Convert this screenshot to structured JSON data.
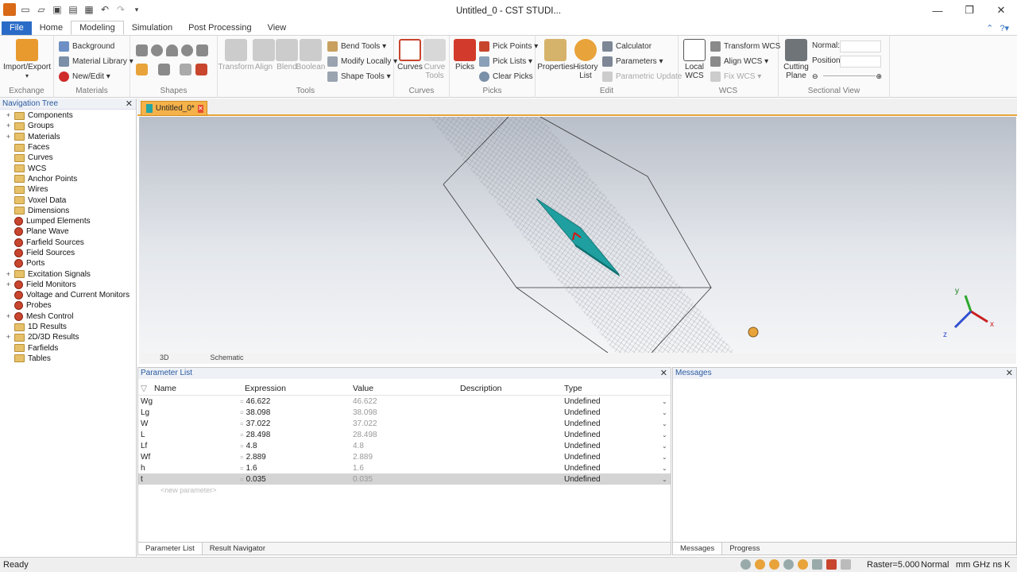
{
  "window": {
    "title": "Untitled_0 - CST STUDI..."
  },
  "ribbon_tabs": [
    {
      "label": "File"
    },
    {
      "label": "Home"
    },
    {
      "label": "Modeling"
    },
    {
      "label": "Simulation"
    },
    {
      "label": "Post Processing"
    },
    {
      "label": "View"
    }
  ],
  "ribbon": {
    "exchange": {
      "label": "Exchange",
      "import_export": "Import/Export"
    },
    "materials": {
      "label": "Materials",
      "background": "Background",
      "material_library": "Material Library ▾",
      "new_edit": "New/Edit ▾"
    },
    "shapes": {
      "label": "Shapes"
    },
    "tools": {
      "label": "Tools",
      "transform": "Transform",
      "align": "Align",
      "blend": "Blend",
      "boolean": "Boolean",
      "bend_tools": "Bend Tools ▾",
      "modify_locally": "Modify Locally ▾",
      "shape_tools": "Shape Tools ▾"
    },
    "curves": {
      "label": "Curves",
      "curves": "Curves",
      "curve_tools": "Curve Tools"
    },
    "picks": {
      "label": "Picks",
      "picks": "Picks",
      "pick_points": "Pick Points ▾",
      "pick_lists": "Pick Lists ▾",
      "clear_picks": "Clear Picks"
    },
    "edit": {
      "label": "Edit",
      "properties": "Properties",
      "history_list": "History List",
      "calculator": "Calculator",
      "parameters": "Parameters ▾",
      "parametric_update": "Parametric Update"
    },
    "wcs": {
      "label": "WCS",
      "local_wcs": "Local WCS",
      "transform_wcs": "Transform WCS",
      "align_wcs": "Align WCS ▾",
      "fix_wcs": "Fix WCS ▾"
    },
    "sectional": {
      "label": "Sectional View",
      "cutting_plane": "Cutting Plane",
      "normal_label": "Normal:",
      "position_label": "Position:"
    }
  },
  "nav_tree": {
    "title": "Navigation Tree",
    "items": [
      {
        "label": "Components",
        "expand": "+",
        "icon": "folder"
      },
      {
        "label": "Groups",
        "expand": "+",
        "icon": "folder"
      },
      {
        "label": "Materials",
        "expand": "+",
        "icon": "folder"
      },
      {
        "label": "Faces",
        "expand": "",
        "icon": "folder"
      },
      {
        "label": "Curves",
        "expand": "",
        "icon": "folder"
      },
      {
        "label": "WCS",
        "expand": "",
        "icon": "folder"
      },
      {
        "label": "Anchor Points",
        "expand": "",
        "icon": "folder"
      },
      {
        "label": "Wires",
        "expand": "",
        "icon": "folder"
      },
      {
        "label": "Voxel Data",
        "expand": "",
        "icon": "folder"
      },
      {
        "label": "Dimensions",
        "expand": "",
        "icon": "folder"
      },
      {
        "label": "Lumped Elements",
        "expand": "",
        "icon": "red-folder"
      },
      {
        "label": "Plane Wave",
        "expand": "",
        "icon": "red-folder"
      },
      {
        "label": "Farfield Sources",
        "expand": "",
        "icon": "red-folder"
      },
      {
        "label": "Field Sources",
        "expand": "",
        "icon": "red-folder"
      },
      {
        "label": "Ports",
        "expand": "",
        "icon": "red-folder"
      },
      {
        "label": "Excitation Signals",
        "expand": "+",
        "icon": "folder"
      },
      {
        "label": "Field Monitors",
        "expand": "+",
        "icon": "red-folder"
      },
      {
        "label": "Voltage and Current Monitors",
        "expand": "",
        "icon": "red-folder"
      },
      {
        "label": "Probes",
        "expand": "",
        "icon": "red-folder"
      },
      {
        "label": "Mesh Control",
        "expand": "+",
        "icon": "red-folder"
      },
      {
        "label": "1D Results",
        "expand": "",
        "icon": "folder"
      },
      {
        "label": "2D/3D Results",
        "expand": "+",
        "icon": "folder"
      },
      {
        "label": "Farfields",
        "expand": "",
        "icon": "folder"
      },
      {
        "label": "Tables",
        "expand": "",
        "icon": "folder"
      }
    ]
  },
  "document_tab": {
    "label": "Untitled_0*"
  },
  "view_tabs": [
    {
      "label": "3D"
    },
    {
      "label": "Schematic"
    }
  ],
  "axes": {
    "x": "x",
    "y": "y",
    "z": "z"
  },
  "parameter_list": {
    "title": "Parameter List",
    "columns": {
      "name": "Name",
      "expression": "Expression",
      "value": "Value",
      "description": "Description",
      "type": "Type"
    },
    "rows": [
      {
        "name": "Wg",
        "expression": "46.622",
        "value": "46.622",
        "type": "Undefined"
      },
      {
        "name": "Lg",
        "expression": "38.098",
        "value": "38.098",
        "type": "Undefined"
      },
      {
        "name": "W",
        "expression": "37.022",
        "value": "37.022",
        "type": "Undefined"
      },
      {
        "name": "L",
        "expression": "28.498",
        "value": "28.498",
        "type": "Undefined"
      },
      {
        "name": "Lf",
        "expression": "4.8",
        "value": "4.8",
        "type": "Undefined"
      },
      {
        "name": "Wf",
        "expression": "2.889",
        "value": "2.889",
        "type": "Undefined"
      },
      {
        "name": "h",
        "expression": "1.6",
        "value": "1.6",
        "type": "Undefined"
      },
      {
        "name": "t",
        "expression": "0.035",
        "value": "0.035",
        "type": "Undefined"
      }
    ],
    "new_param": "<new parameter>",
    "bottom_tabs": [
      {
        "label": "Parameter List"
      },
      {
        "label": "Result Navigator"
      }
    ]
  },
  "messages": {
    "title": "Messages",
    "bottom_tabs": [
      {
        "label": "Messages"
      },
      {
        "label": "Progress"
      }
    ]
  },
  "status": {
    "ready": "Ready",
    "raster": "Raster=5.000",
    "mode": "Normal",
    "units": "mm  GHz  ns  K"
  }
}
